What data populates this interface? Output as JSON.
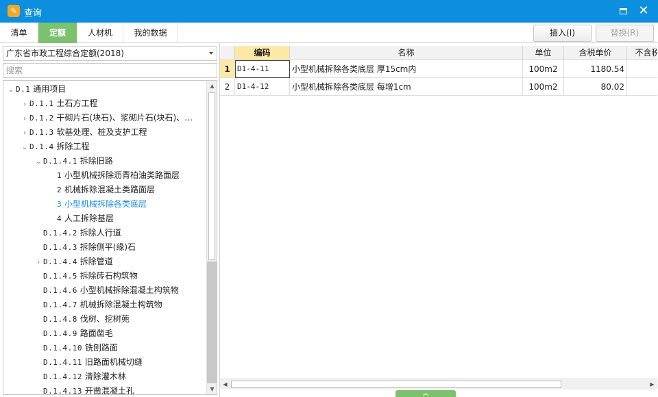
{
  "window": {
    "title": "查询",
    "app_icon": "app-logo-icon",
    "maximize_icon": "maximize-icon",
    "close_icon": "close-icon",
    "close_glyph": "✕"
  },
  "tabs": [
    {
      "label": "清单",
      "active": false
    },
    {
      "label": "定额",
      "active": true
    },
    {
      "label": "人材机",
      "active": false
    },
    {
      "label": "我的数据",
      "active": false
    }
  ],
  "toolbar": {
    "insert_label": "插入(I)",
    "replace_label": "替换(R)"
  },
  "colors": {
    "title_bar": "#0b8fde",
    "active_tab": "#7cc26e",
    "selected_text": "#1a8de0",
    "header_highlight": "#fde8a6"
  },
  "left": {
    "library": "广东省市政工程综合定额(2018)",
    "search_placeholder": "搜索",
    "tree": [
      {
        "arrow": "⌄",
        "code": "D.1",
        "label": "通用项目",
        "level": 0,
        "selected": false
      },
      {
        "arrow": "›",
        "code": "D.1.1",
        "label": "土石方工程",
        "level": 1,
        "selected": false
      },
      {
        "arrow": "›",
        "code": "D.1.2",
        "label": "干砌片石(块石)、浆砌片石(块石)、…",
        "level": 1,
        "selected": false
      },
      {
        "arrow": "›",
        "code": "D.1.3",
        "label": "软基处理、桩及支护工程",
        "level": 1,
        "selected": false
      },
      {
        "arrow": "⌄",
        "code": "D.1.4",
        "label": "拆除工程",
        "level": 1,
        "selected": false
      },
      {
        "arrow": "⌄",
        "code": "D.1.4.1",
        "label": "拆除旧路",
        "level": 2,
        "selected": false
      },
      {
        "arrow": "",
        "code": "1",
        "label": "小型机械拆除沥青柏油类路面层",
        "level": 3,
        "selected": false
      },
      {
        "arrow": "",
        "code": "2",
        "label": "机械拆除混凝土类路面层",
        "level": 3,
        "selected": false
      },
      {
        "arrow": "",
        "code": "3",
        "label": "小型机械拆除各类底层",
        "level": 3,
        "selected": true
      },
      {
        "arrow": "",
        "code": "4",
        "label": "人工拆除基层",
        "level": 3,
        "selected": false
      },
      {
        "arrow": "",
        "code": "D.1.4.2",
        "label": "拆除人行道",
        "level": 2,
        "selected": false
      },
      {
        "arrow": "",
        "code": "D.1.4.3",
        "label": "拆除侧平(缘)石",
        "level": 2,
        "selected": false
      },
      {
        "arrow": "›",
        "code": "D.1.4.4",
        "label": "拆除管道",
        "level": 2,
        "selected": false
      },
      {
        "arrow": "",
        "code": "D.1.4.5",
        "label": "拆除砖石构筑物",
        "level": 2,
        "selected": false
      },
      {
        "arrow": "",
        "code": "D.1.4.6",
        "label": "小型机械拆除混凝土构筑物",
        "level": 2,
        "selected": false
      },
      {
        "arrow": "",
        "code": "D.1.4.7",
        "label": "机械拆除混凝土构筑物",
        "level": 2,
        "selected": false
      },
      {
        "arrow": "",
        "code": "D.1.4.8",
        "label": "伐树、挖树蔸",
        "level": 2,
        "selected": false
      },
      {
        "arrow": "",
        "code": "D.1.4.9",
        "label": "路面凿毛",
        "level": 2,
        "selected": false
      },
      {
        "arrow": "",
        "code": "D.1.4.10",
        "label": "铣刨路面",
        "level": 2,
        "selected": false
      },
      {
        "arrow": "",
        "code": "D.1.4.11",
        "label": "旧路面机械切缝",
        "level": 2,
        "selected": false
      },
      {
        "arrow": "",
        "code": "D.1.4.12",
        "label": "清除灌木林",
        "level": 2,
        "selected": false
      },
      {
        "arrow": "",
        "code": "D.1.4.13",
        "label": "开凿混凝土孔",
        "level": 2,
        "selected": false
      }
    ]
  },
  "grid": {
    "columns": [
      "编码",
      "名称",
      "单位",
      "含税单价",
      "不含税"
    ],
    "rows": [
      {
        "num": "1",
        "code": "D1-4-11",
        "name": "小型机械拆除各类底层 厚15cm内",
        "unit": "100m2",
        "price": "1180.54",
        "price_ex": ""
      },
      {
        "num": "2",
        "code": "D1-4-12",
        "name": "小型机械拆除各类底层 每增1cm",
        "unit": "100m2",
        "price": "80.02",
        "price_ex": ""
      }
    ]
  },
  "scroll": {
    "up": "▲",
    "down": "▼",
    "left": "◀",
    "right": "▶",
    "collapse": "︽"
  }
}
